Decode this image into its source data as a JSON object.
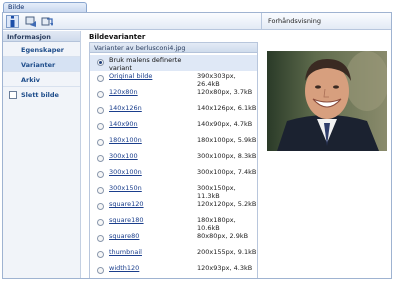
{
  "tab": {
    "label": "Bilde"
  },
  "toolbar": {
    "icons": [
      "info-icon",
      "image-edit-icon",
      "undo-icon"
    ],
    "preview_title": "Forhåndsvisning"
  },
  "nav": {
    "header": "Informasjon",
    "items": [
      {
        "label": "Egenskaper",
        "selected": false
      },
      {
        "label": "Varianter",
        "selected": true
      },
      {
        "label": "Arkiv",
        "selected": false
      }
    ],
    "delete_label": "Slett bilde"
  },
  "main": {
    "title": "Bildevarianter",
    "box_header": "Varianter av berlusconi4.jpg",
    "options": [
      {
        "label": "Bruk malens definerte variant",
        "size": "",
        "selected": true,
        "plain": true
      },
      {
        "label": "Original bilde",
        "size": "390x303px, 26.4kB"
      },
      {
        "label": "120x80n",
        "size": "120x80px, 3.7kB"
      },
      {
        "label": "140x126n",
        "size": "140x126px, 6.1kB"
      },
      {
        "label": "140x90n",
        "size": "140x90px, 4.7kB"
      },
      {
        "label": "180x100n",
        "size": "180x100px, 5.9kB"
      },
      {
        "label": "300x100",
        "size": "300x100px, 8.3kB"
      },
      {
        "label": "300x100n",
        "size": "300x100px, 7.4kB"
      },
      {
        "label": "300x150n",
        "size": "300x150px, 11.3kB"
      },
      {
        "label": "square120",
        "size": "120x120px, 5.2kB"
      },
      {
        "label": "square180",
        "size": "180x180px, 10.6kB"
      },
      {
        "label": "square80",
        "size": "80x80px, 2.9kB"
      },
      {
        "label": "thumbnail",
        "size": "200x155px, 9.1kB"
      },
      {
        "label": "width120",
        "size": "120x93px, 4.3kB"
      }
    ]
  }
}
